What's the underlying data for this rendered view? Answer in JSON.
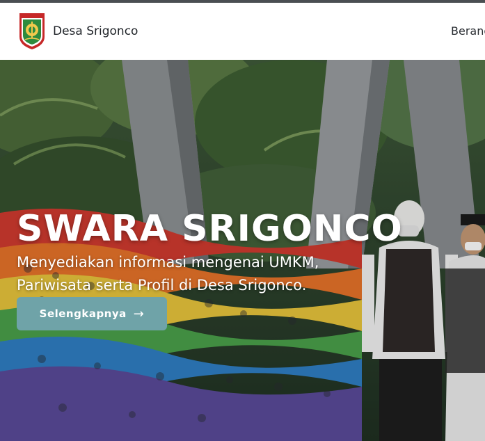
{
  "navbar": {
    "brand": "Desa Srigonco",
    "links": [
      "Beranda"
    ],
    "logo_icon": "regency-shield-emblem"
  },
  "hero": {
    "title": "SWARA SRIGONCO",
    "subtitle": "Menyediakan informasi mengenai UMKM, Pariwisata serta Profil di Desa Srigonco.",
    "cta_label": "Selengkapnya",
    "cta_icon": "arrow-right-icon"
  },
  "colors": {
    "cta_bg": "#6fa3a8",
    "hero_text": "#ffffff",
    "nav_bg": "#ffffff"
  }
}
